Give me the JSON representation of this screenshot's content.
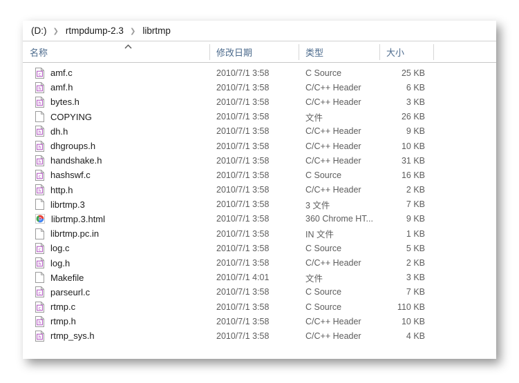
{
  "window": {
    "title": "librtmp"
  },
  "address_bar": {
    "breadcrumbs": [
      {
        "label": "(D:)"
      },
      {
        "label": "rtmpdump-2.3"
      },
      {
        "label": "librtmp"
      }
    ],
    "separator": "❯"
  },
  "columns": {
    "name": "名称",
    "date_modified": "修改日期",
    "type": "类型",
    "size": "大小",
    "sort_indicator": "ascending"
  },
  "files": [
    {
      "name": "amf.c",
      "icon": "c-source-file-icon",
      "date": "2010/7/1 3:58",
      "type": "C Source",
      "size": "25 KB"
    },
    {
      "name": "amf.h",
      "icon": "h-header-file-icon",
      "date": "2010/7/1 3:58",
      "type": "C/C++ Header",
      "size": "6 KB"
    },
    {
      "name": "bytes.h",
      "icon": "h-header-file-icon",
      "date": "2010/7/1 3:58",
      "type": "C/C++ Header",
      "size": "3 KB"
    },
    {
      "name": "COPYING",
      "icon": "blank-file-icon",
      "date": "2010/7/1 3:58",
      "type": "文件",
      "size": "26 KB"
    },
    {
      "name": "dh.h",
      "icon": "h-header-file-icon",
      "date": "2010/7/1 3:58",
      "type": "C/C++ Header",
      "size": "9 KB"
    },
    {
      "name": "dhgroups.h",
      "icon": "h-header-file-icon",
      "date": "2010/7/1 3:58",
      "type": "C/C++ Header",
      "size": "10 KB"
    },
    {
      "name": "handshake.h",
      "icon": "h-header-file-icon",
      "date": "2010/7/1 3:58",
      "type": "C/C++ Header",
      "size": "31 KB"
    },
    {
      "name": "hashswf.c",
      "icon": "c-source-file-icon",
      "date": "2010/7/1 3:58",
      "type": "C Source",
      "size": "16 KB"
    },
    {
      "name": "http.h",
      "icon": "h-header-file-icon",
      "date": "2010/7/1 3:58",
      "type": "C/C++ Header",
      "size": "2 KB"
    },
    {
      "name": "librtmp.3",
      "icon": "blank-file-icon",
      "date": "2010/7/1 3:58",
      "type": "3 文件",
      "size": "7 KB"
    },
    {
      "name": "librtmp.3.html",
      "icon": "chrome-browser-icon",
      "date": "2010/7/1 3:58",
      "type": "360 Chrome HT...",
      "size": "9 KB"
    },
    {
      "name": "librtmp.pc.in",
      "icon": "blank-file-icon",
      "date": "2010/7/1 3:58",
      "type": "IN 文件",
      "size": "1 KB"
    },
    {
      "name": "log.c",
      "icon": "c-source-file-icon",
      "date": "2010/7/1 3:58",
      "type": "C Source",
      "size": "5 KB"
    },
    {
      "name": "log.h",
      "icon": "h-header-file-icon",
      "date": "2010/7/1 3:58",
      "type": "C/C++ Header",
      "size": "2 KB"
    },
    {
      "name": "Makefile",
      "icon": "blank-file-icon",
      "date": "2010/7/1 4:01",
      "type": "文件",
      "size": "3 KB"
    },
    {
      "name": "parseurl.c",
      "icon": "c-source-file-icon",
      "date": "2010/7/1 3:58",
      "type": "C Source",
      "size": "7 KB"
    },
    {
      "name": "rtmp.c",
      "icon": "c-source-file-icon",
      "date": "2010/7/1 3:58",
      "type": "C Source",
      "size": "110 KB"
    },
    {
      "name": "rtmp.h",
      "icon": "h-header-file-icon",
      "date": "2010/7/1 3:58",
      "type": "C/C++ Header",
      "size": "10 KB"
    },
    {
      "name": "rtmp_sys.h",
      "icon": "h-header-file-icon",
      "date": "2010/7/1 3:58",
      "type": "C/C++ Header",
      "size": "4 KB"
    }
  ],
  "colors": {
    "header_text": "#4b6a8c",
    "body_text": "#1b1b1b",
    "secondary_text": "#5d5d5d",
    "rule": "#c8c8c8",
    "icon_letter": "#b04ec0",
    "window_bg": "#ffffff"
  }
}
